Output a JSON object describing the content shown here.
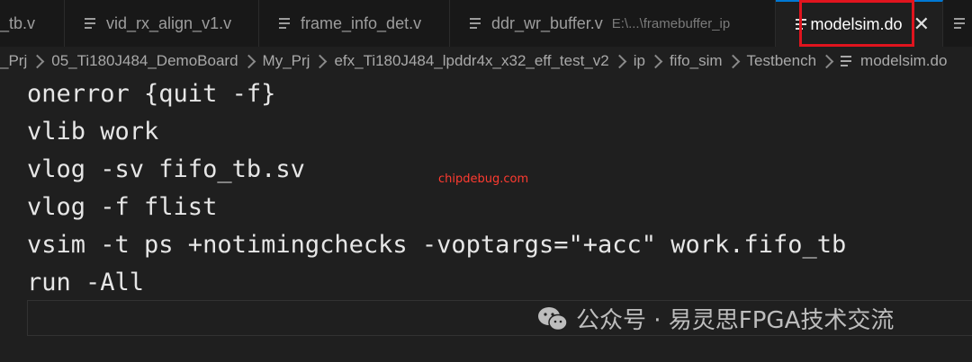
{
  "tabs": [
    {
      "label": "_tb.v",
      "active": false
    },
    {
      "label": "vid_rx_align_v1.v",
      "active": false
    },
    {
      "label": "frame_info_det.v",
      "active": false
    },
    {
      "label": "ddr_wr_buffer.v",
      "desc": "E:\\...\\framebuffer_ip",
      "active": false
    },
    {
      "label": "modelsim.do",
      "active": true
    }
  ],
  "breadcrumb": [
    "_Prj",
    "05_Ti180J484_DemoBoard",
    "My_Prj",
    "efx_Ti180J484_lpddr4x_x32_eff_test_v2",
    "ip",
    "fifo_sim",
    "Testbench",
    "modelsim.do"
  ],
  "code": [
    "onerror {quit -f}",
    "vlib work",
    "vlog -sv fifo_tb.sv",
    "vlog -f flist",
    "vsim -t ps +notimingchecks -voptargs=\"+acc\" work.fifo_tb",
    "run -All"
  ],
  "watermarks": {
    "site": "chipdebug.com",
    "channel": "公众号 · 易灵思FPGA技术交流"
  },
  "colors": {
    "accent": "#0078d4",
    "highlight": "#e0141e"
  }
}
